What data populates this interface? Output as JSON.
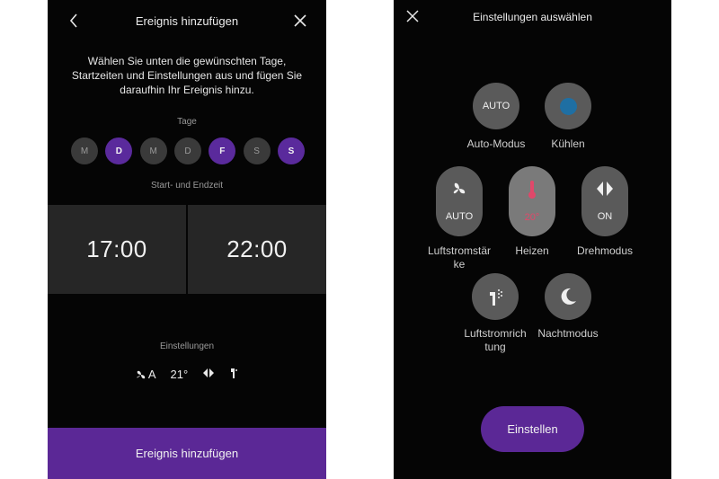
{
  "left": {
    "header": {
      "title": "Ereignis hinzufügen",
      "back_icon": "chevron-left-icon",
      "close_icon": "close-icon"
    },
    "description": "Wählen Sie unten die gewünschten Tage, Startzeiten und Einstellungen aus und fügen Sie daraufhin Ihr Ereignis hinzu.",
    "days_label": "Tage",
    "days": [
      {
        "label": "M",
        "active": false
      },
      {
        "label": "D",
        "active": true
      },
      {
        "label": "M",
        "active": false
      },
      {
        "label": "D",
        "active": false
      },
      {
        "label": "F",
        "active": true
      },
      {
        "label": "S",
        "active": false
      },
      {
        "label": "S",
        "active": true
      }
    ],
    "time_label": "Start- und Endzeit",
    "start_time": "17:00",
    "end_time": "22:00",
    "settings_label": "Einstellungen",
    "settings": {
      "fan_speed": "A",
      "temperature": "21°"
    },
    "add_button": "Ereignis hinzufügen",
    "colors": {
      "accent": "#5b2896",
      "day_active": "#5a2a9c",
      "day_inactive": "#3a3a3a"
    }
  },
  "right": {
    "header": {
      "title": "Einstellungen auswählen",
      "close_icon": "close-icon"
    },
    "auto_mode": {
      "button_text": "AUTO",
      "label": "Auto-Modus"
    },
    "cool": {
      "label": "Kühlen",
      "color": "#1f6fa3"
    },
    "airflow_speed": {
      "value": "AUTO",
      "label_line1": "Luftstromstär",
      "label_line2": "ke"
    },
    "heat": {
      "value": "20°",
      "label": "Heizen",
      "color": "#e0486a"
    },
    "oscillation": {
      "value": "ON",
      "label": "Drehmodus"
    },
    "airflow_direction": {
      "label_line1": "Luftstromrich",
      "label_line2": "tung"
    },
    "night_mode": {
      "label": "Nachtmodus"
    },
    "apply_button": "Einstellen"
  }
}
